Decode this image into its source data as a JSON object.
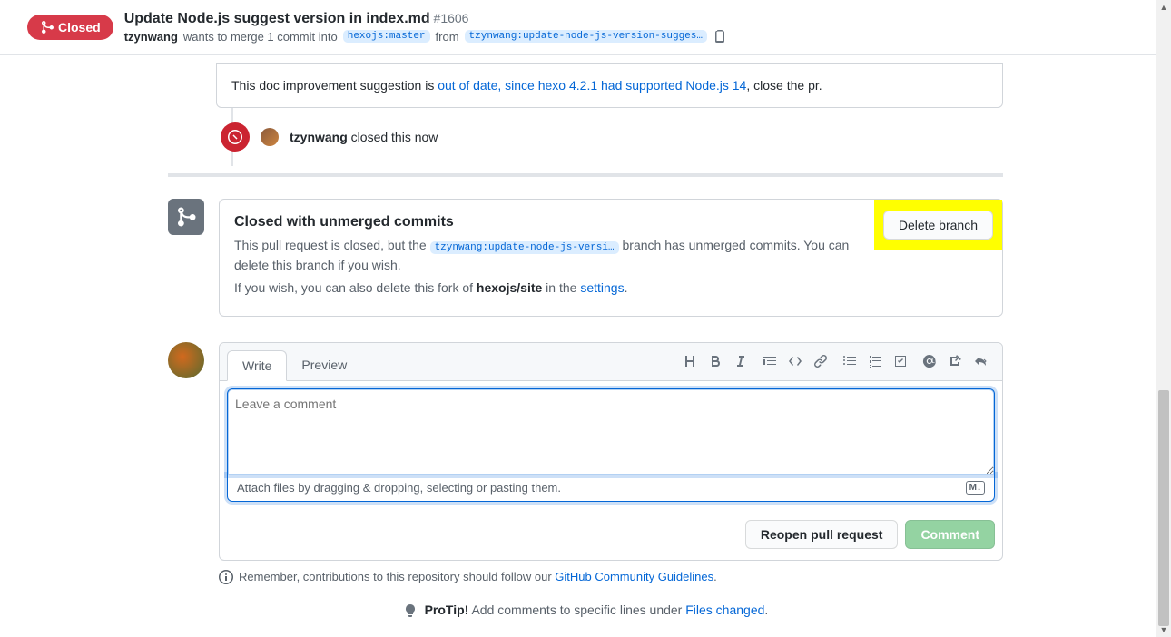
{
  "header": {
    "state_label": "Closed",
    "title": "Update Node.js suggest version in index.md",
    "pr_number": "#1606",
    "author": "tzynwang",
    "merge_text_1": "wants to merge 1 commit into",
    "base_branch": "hexojs:master",
    "merge_text_2": "from",
    "head_branch": "tzynwang:update-node-js-version-sugges…"
  },
  "prev_comment": {
    "text_1": "This doc improvement suggestion is ",
    "link": "out of date, since hexo 4.2.1 had supported Node.js 14",
    "text_2": ", close the pr."
  },
  "closed_event": {
    "actor": "tzynwang",
    "action": "closed this now"
  },
  "merge_status": {
    "title": "Closed with unmerged commits",
    "line1_a": "This pull request is closed, but the ",
    "line1_branch": "tzynwang:update-node-js-versi…",
    "line1_b": " branch has unmerged commits. You can delete this branch if you wish.",
    "line2_a": "If you wish, you can also delete this fork of ",
    "line2_repo": "hexojs/site",
    "line2_b": " in the ",
    "line2_link": "settings",
    "delete_btn": "Delete branch"
  },
  "comment_form": {
    "tab_write": "Write",
    "tab_preview": "Preview",
    "placeholder": "Leave a comment",
    "attach_text": "Attach files by dragging & dropping, selecting or pasting them.",
    "md_badge": "M↓",
    "reopen_btn": "Reopen pull request",
    "submit_btn": "Comment"
  },
  "footer": {
    "note_a": "Remember, contributions to this repository should follow our ",
    "note_link": "GitHub Community Guidelines",
    "protip_label": "ProTip!",
    "protip_text": " Add comments to specific lines under ",
    "protip_link": "Files changed"
  }
}
